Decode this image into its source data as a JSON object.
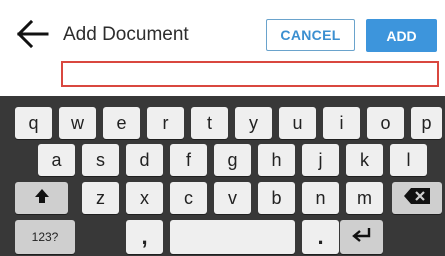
{
  "header": {
    "back_icon": "arrow-left-icon",
    "title": "Add Document",
    "cancel_label": "CANCEL",
    "add_label": "ADD"
  },
  "document_input": {
    "value": ""
  },
  "keyboard": {
    "row1": [
      "q",
      "w",
      "e",
      "r",
      "t",
      "y",
      "u",
      "i",
      "o",
      "p"
    ],
    "row2": [
      "a",
      "s",
      "d",
      "f",
      "g",
      "h",
      "j",
      "k",
      "l"
    ],
    "row3": [
      "z",
      "x",
      "c",
      "v",
      "b",
      "n",
      "m"
    ],
    "shift_icon": "shift-arrow-icon",
    "backspace_icon": "backspace-icon",
    "numbers_label": "123?",
    "comma": ",",
    "period": ".",
    "enter_icon": "enter-return-icon",
    "accent_colors": {
      "primary": "#3d95dc",
      "error_border": "#d9473f",
      "keyboard_bg": "#383838"
    }
  }
}
